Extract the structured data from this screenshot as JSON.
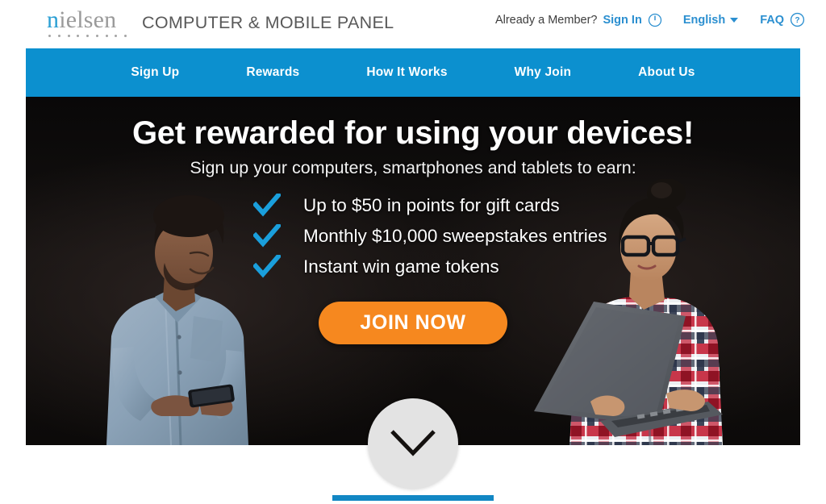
{
  "header": {
    "logo_text_prefix": "n",
    "logo_text_rest": "ielsen",
    "panel_title": "COMPUTER & MOBILE PANEL",
    "member_prompt": "Already a Member?",
    "sign_in_label": "Sign In",
    "power_icon": "power-icon",
    "language_label": "English",
    "caret_icon": "chevron-down-icon",
    "faq_label": "FAQ",
    "help_icon": "question-circle-icon"
  },
  "nav": {
    "items": [
      {
        "label": "Sign Up"
      },
      {
        "label": "Rewards"
      },
      {
        "label": "How It Works"
      },
      {
        "label": "Why Join"
      },
      {
        "label": "About Us"
      }
    ]
  },
  "hero": {
    "headline": "Get rewarded for using your devices!",
    "subheadline": "Sign up your computers, smartphones and tablets to earn:",
    "bullets": [
      {
        "text": "Up to $50 in points for gift cards",
        "icon": "check-icon"
      },
      {
        "text": "Monthly $10,000 sweepstakes entries",
        "icon": "check-icon"
      },
      {
        "text": "Instant win game tokens",
        "icon": "check-icon"
      }
    ],
    "cta_label": "JOIN NOW",
    "photo_left": "man-with-smartphone-photo",
    "photo_right": "woman-with-laptop-photo"
  },
  "scroll": {
    "icon": "chevron-down-icon"
  },
  "colors": {
    "brand_blue": "#0c90cf",
    "link_blue": "#2b8fd0",
    "cta_orange": "#f6881f",
    "hero_black": "#0a0909",
    "rule_blue": "#1287c4",
    "logo_gray": "#9a9a9a",
    "logo_blue": "#2b9fd4"
  }
}
